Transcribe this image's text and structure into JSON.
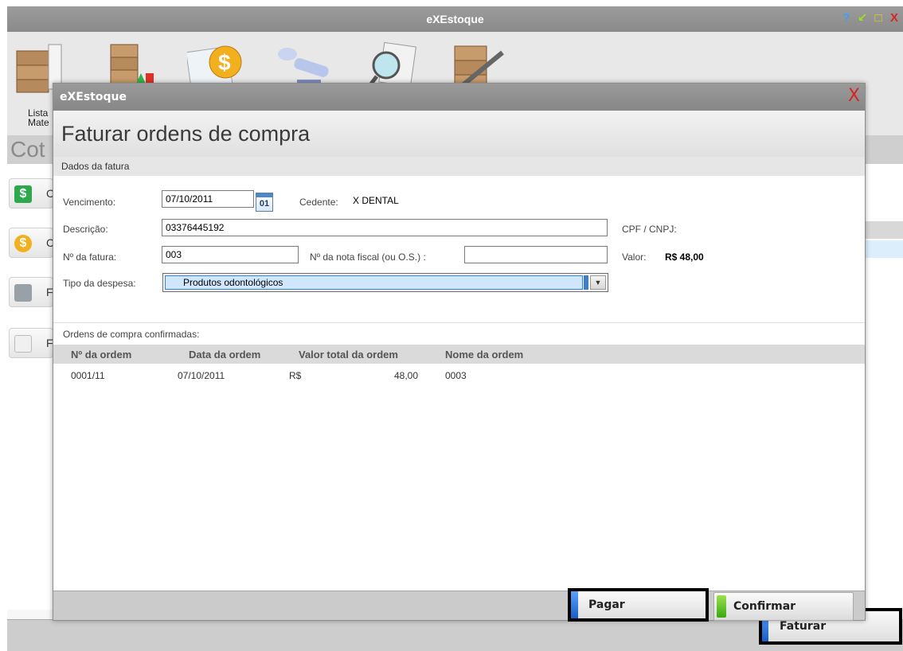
{
  "app": {
    "title": "eXEstoque",
    "toolbar_first_label_line1": "Lista",
    "toolbar_first_label_line2": "Mate",
    "section_title": "Cot",
    "side_items": [
      "C",
      "C",
      "F",
      "F"
    ],
    "faturar_label": "Faturar",
    "controls": [
      "?",
      "↙",
      "□",
      "X"
    ]
  },
  "dialog": {
    "window_title": "eXEstoque",
    "close_glyph": "X",
    "heading": "Faturar ordens de compra",
    "section_label": "Dados da fatura",
    "fields": {
      "vencimento_label": "Vencimento:",
      "vencimento_value": "07/10/2011",
      "calendar_label": "01",
      "cedente_label": "Cedente:",
      "cedente_value": "X DENTAL",
      "descricao_label": "Descrição:",
      "descricao_value": "03376445192",
      "cpf_label": "CPF / CNPJ:",
      "fatura_label": "Nº da fatura:",
      "fatura_value": "003",
      "nota_label": "Nº da nota fiscal (ou O.S.) :",
      "nota_value": "",
      "valor_label": "Valor:",
      "valor_value": "R$ 48,00",
      "tipo_label": "Tipo da despesa:",
      "tipo_value": "Produtos odontológicos",
      "tipo_arrow": "▼"
    },
    "orders_label": "Ordens de compra confirmadas:",
    "table": {
      "headers": [
        "Nº da ordem",
        "Data da ordem",
        "Valor total da ordem",
        "Nome da ordem"
      ],
      "rows": [
        {
          "numero": "0001/11",
          "data": "07/10/2011",
          "moeda": "R$",
          "valor": "48,00",
          "nome": "0003"
        }
      ]
    },
    "buttons": {
      "pagar": "Pagar",
      "confirmar": "Confirmar"
    }
  },
  "colors": {
    "accent_blue": "#1a5cc8",
    "accent_green": "#3aa810",
    "close_red": "#e02020",
    "selection_blue": "#cfe6fc"
  }
}
